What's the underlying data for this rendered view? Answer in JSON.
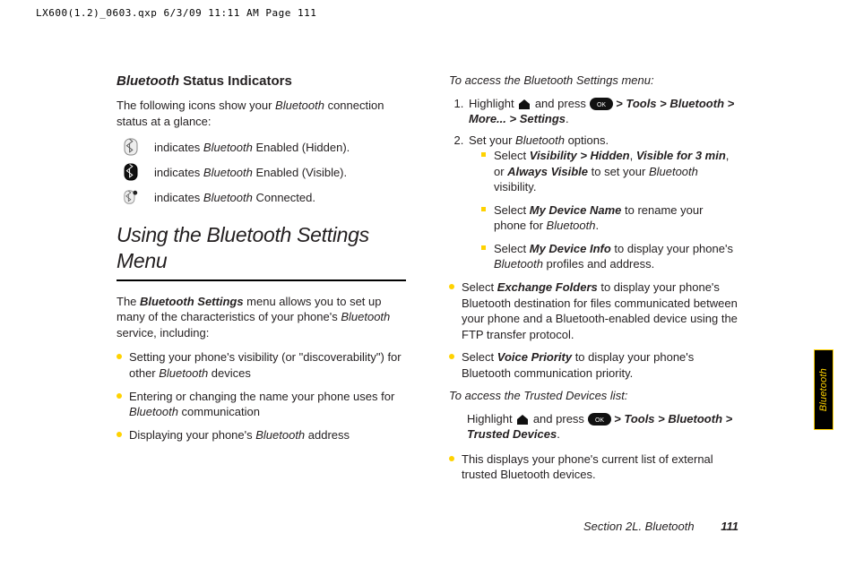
{
  "crop_mark": "LX600(1.2)_0603.qxp  6/3/09  11:11 AM  Page 111",
  "left": {
    "status_heading_prefix": "Bluetooth",
    "status_heading_suffix": " Status Indicators",
    "intro_before": "The following icons show your ",
    "intro_ital": "Bluetooth",
    "intro_after": " connection status at a glance:",
    "row1_before": "indicates ",
    "row1_ital": "Bluetooth",
    "row1_after": " Enabled (Hidden).",
    "row2_before": "indicates ",
    "row2_ital": "Bluetooth",
    "row2_after": " Enabled (Visible).",
    "row3_before": "indicates ",
    "row3_ital": "Bluetooth",
    "row3_after": " Connected.",
    "section_heading": "Using the Bluetooth Settings Menu",
    "para_before": "The ",
    "para_ital1": "Bluetooth Settings",
    "para_mid": " menu allows you to set up many of the characteristics of your phone's ",
    "para_ital2": "Bluetooth",
    "para_after": " service, including:",
    "bul1_before": "Setting your phone's visibility (or \"discoverability\") for other ",
    "bul1_ital": "Bluetooth",
    "bul1_after": " devices",
    "bul2_before": "Entering or changing the name your phone uses for ",
    "bul2_ital": "Bluetooth",
    "bul2_after": " communication",
    "bul3_before": "Displaying your phone's ",
    "bul3_ital": "Bluetooth",
    "bul3_after": " address"
  },
  "right": {
    "access_heading": "To access the Bluetooth Settings menu:",
    "step1_before": "Highlight ",
    "step1_mid": " and press ",
    "step1_path": " > Tools > Bluetooth > More... > Settings",
    "step1_end": ".",
    "step2_before": "Set your ",
    "step2_ital": "Bluetooth",
    "step2_after": " options.",
    "sq1_a": "Select ",
    "sq1_vis": "Visibility > Hidden",
    "sq1_b": ", ",
    "sq1_v3": "Visible for 3 min",
    "sq1_c": ", or ",
    "sq1_av": "Always Visible",
    "sq1_d": " to set your ",
    "sq1_bt": "Bluetooth",
    "sq1_e": " visibility.",
    "sq2_a": "Select ",
    "sq2_mdn": "My Device Name",
    "sq2_b": " to rename your phone for ",
    "sq2_bt": "Bluetooth",
    "sq2_c": ".",
    "sq3_a": "Select ",
    "sq3_mdi": "My Device Info",
    "sq3_b": " to display your phone's ",
    "sq3_bt": "Bluetooth",
    "sq3_c": " profiles and address.",
    "bulA_a": "Select ",
    "bulA_ef": "Exchange Folders",
    "bulA_b": " to display your phone's Bluetooth destination for files communicated between your phone and a Bluetooth-enabled device using the FTP transfer protocol.",
    "bulB_a": "Select ",
    "bulB_vp": "Voice Priority",
    "bulB_b": " to display your phone's Bluetooth communication priority.",
    "trusted_heading": "To access the Trusted Devices list:",
    "tr_before": "Highlight ",
    "tr_mid": " and press ",
    "tr_path": " > Tools > Bluetooth > Trusted Devices",
    "tr_end": ".",
    "tr_bul": "This displays your phone's current list of external trusted Bluetooth devices."
  },
  "footer_section": "Section 2L. Bluetooth",
  "footer_page": "111",
  "side_tab": "Bluetooth"
}
